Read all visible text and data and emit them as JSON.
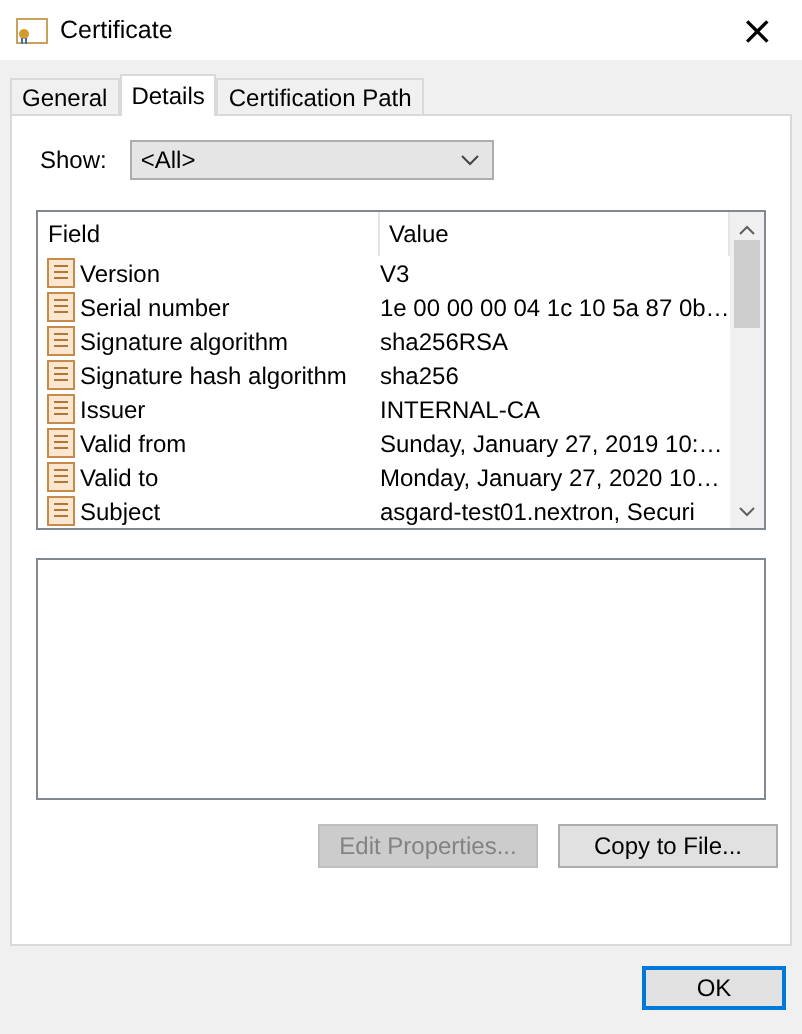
{
  "window": {
    "title": "Certificate",
    "close": "×"
  },
  "tabs": [
    {
      "label": "General",
      "selected": false
    },
    {
      "label": "Details",
      "selected": true
    },
    {
      "label": "Certification Path",
      "selected": false
    }
  ],
  "show": {
    "label": "Show:",
    "value": "<All>"
  },
  "table": {
    "columns": [
      "Field",
      "Value"
    ],
    "rows": [
      {
        "field": "Version",
        "value": "V3"
      },
      {
        "field": "Serial number",
        "value": "1e 00 00 00 04 1c 10 5a 87 0b…"
      },
      {
        "field": "Signature algorithm",
        "value": "sha256RSA"
      },
      {
        "field": "Signature hash algorithm",
        "value": "sha256"
      },
      {
        "field": "Issuer",
        "value": "INTERNAL-CA"
      },
      {
        "field": "Valid from",
        "value": "Sunday, January 27, 2019 10:…"
      },
      {
        "field": "Valid to",
        "value": "Monday, January 27, 2020 10…"
      },
      {
        "field": "Subject",
        "value": "asgard-test01.nextron, Securi"
      }
    ]
  },
  "buttons": [
    {
      "label": "Edit Properties...",
      "disabled": true
    },
    {
      "label": "Copy to File...",
      "disabled": false
    }
  ],
  "ok": "OK"
}
